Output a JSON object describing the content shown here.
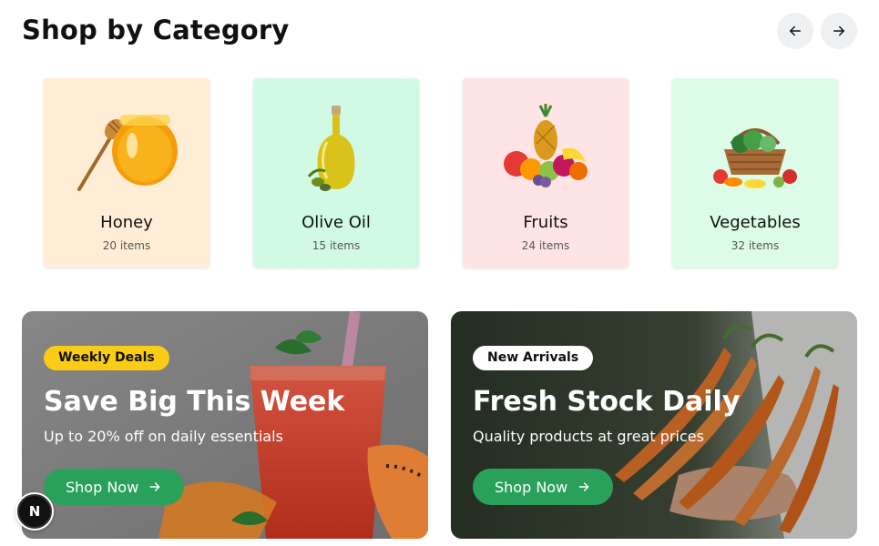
{
  "header": {
    "title": "Shop by Category",
    "prev_icon": "arrow-left-icon",
    "next_icon": "arrow-right-icon"
  },
  "categories": [
    {
      "name": "Honey",
      "count": "20 items",
      "color": "#ffedd5",
      "icon": "honey-jar-icon"
    },
    {
      "name": "Olive Oil",
      "count": "15 items",
      "color": "#d1fae5",
      "icon": "olive-oil-bottle-icon"
    },
    {
      "name": "Fruits",
      "count": "24 items",
      "color": "#ffe4e6",
      "icon": "fruit-basket-icon"
    },
    {
      "name": "Vegetables",
      "count": "32 items",
      "color": "#dcfce7",
      "icon": "vegetable-basket-icon"
    }
  ],
  "banners": [
    {
      "badge": "Weekly Deals",
      "badge_color": "#facc15",
      "title": "Save Big This Week",
      "subtitle": "Up to 20% off on daily essentials",
      "button": "Shop Now",
      "image": "juice-papaya-photo"
    },
    {
      "badge": "New Arrivals",
      "badge_color": "#ffffff",
      "title": "Fresh Stock Daily",
      "subtitle": "Quality products at great prices",
      "button": "Shop Now",
      "image": "carrots-photo"
    }
  ],
  "accent_color": "#2aa15a",
  "dev_badge": {
    "letter": "N",
    "icon": "nextjs-icon"
  }
}
